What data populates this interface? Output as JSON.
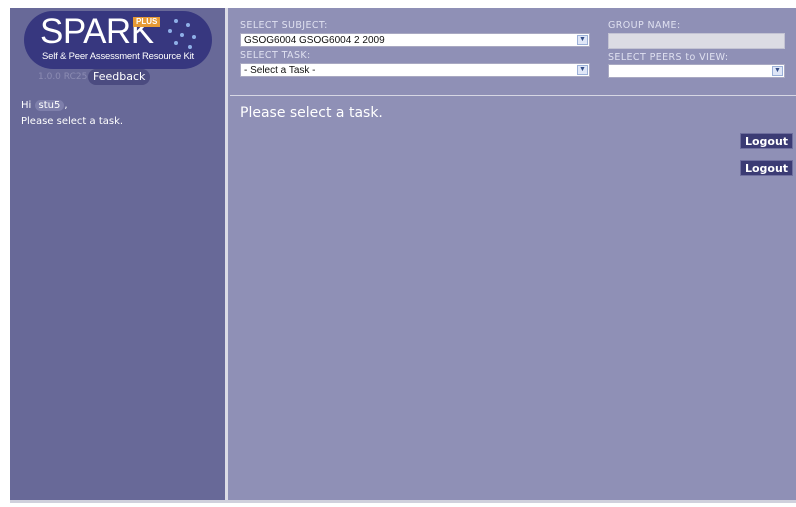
{
  "logo": {
    "word": "SPARK",
    "badge": "PLUS",
    "subtitle": "Self & Peer Assessment Resource Kit"
  },
  "sidebar": {
    "version": "1.0.0 RC25",
    "feedback_label": "Feedback",
    "greeting_prefix": "Hi",
    "username": "stu5",
    "greeting_suffix": ",",
    "message": "Please select a task."
  },
  "form": {
    "subject_label": "SELECT SUBJECT:",
    "subject_value": "GSOG6004 GSOG6004 2 2009",
    "task_label": "SELECT TASK:",
    "task_value": "- Select a Task -",
    "group_label": "GROUP NAME:",
    "group_value": "",
    "peers_label": "SELECT PEERS to VIEW:",
    "peers_value": ""
  },
  "main": {
    "message": "Please select a task."
  },
  "buttons": {
    "logout_1": "Logout",
    "logout_2": "Logout"
  },
  "colors": {
    "sidebar": "#686998",
    "main": "#8f90b6",
    "logo": "#37377f",
    "accent": "#e69a35",
    "button": "#3b3b74"
  },
  "icons": {
    "dropdown": "chevron-down-icon"
  }
}
